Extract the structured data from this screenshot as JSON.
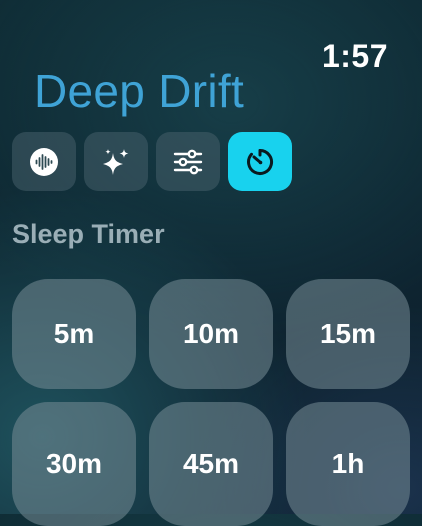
{
  "status": {
    "time": "1:57"
  },
  "app": {
    "title": "Deep Drift"
  },
  "tabs": [
    {
      "name": "sound",
      "icon": "waveform-icon",
      "active": false
    },
    {
      "name": "effects",
      "icon": "sparkles-icon",
      "active": false
    },
    {
      "name": "mixer",
      "icon": "sliders-icon",
      "active": false
    },
    {
      "name": "timer",
      "icon": "timer-icon",
      "active": true
    }
  ],
  "sleep_timer": {
    "title": "Sleep Timer",
    "options": [
      "5m",
      "10m",
      "15m",
      "30m",
      "45m",
      "1h"
    ]
  },
  "colors": {
    "accent": "#18d2ee",
    "title": "#3fa3d6",
    "section_title": "#9aaeb6"
  }
}
